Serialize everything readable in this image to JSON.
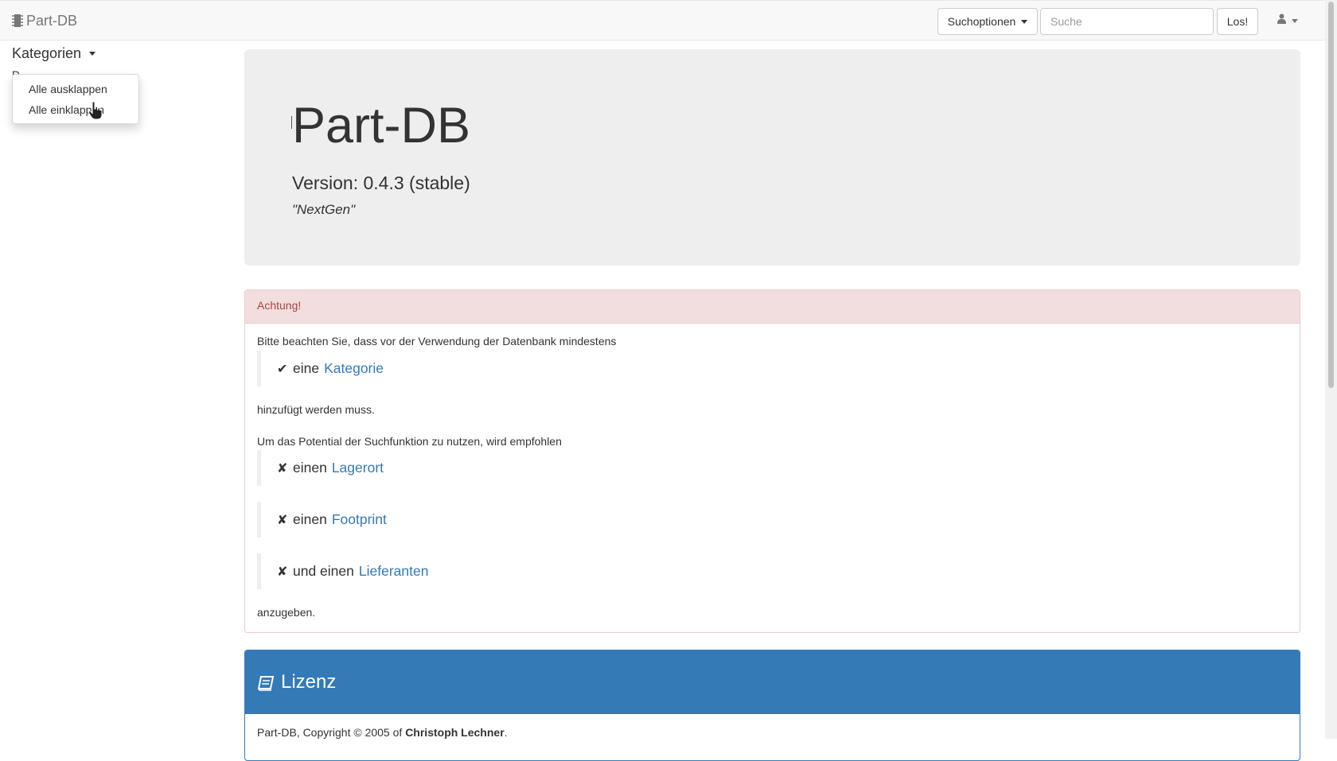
{
  "navbar": {
    "brand": "Part-DB",
    "search_options_label": "Suchoptionen",
    "search_placeholder": "Suche",
    "search_value": "",
    "go_label": "Los!",
    "user_icon": "user-icon"
  },
  "sidebar": {
    "title": "Kategorien",
    "stub_text": "D",
    "dropdown": [
      {
        "label": "Alle ausklappen"
      },
      {
        "label": "Alle einklappen"
      }
    ]
  },
  "jumbotron": {
    "title": "Part-DB",
    "version": "Version: 0.4.3 (stable)",
    "codename": "\"NextGen\""
  },
  "warning": {
    "heading": "Achtung!",
    "intro": "Bitte beachten Sie, dass vor der Verwendung der Datenbank mindestens",
    "required": {
      "mark": "✔",
      "prefix": "eine",
      "link": "Kategorie"
    },
    "after_required": "hinzufügt werden muss.",
    "recommend_intro": "Um das Potential der Suchfunktion zu nutzen, wird empfohlen",
    "recommended": [
      {
        "mark": "✘",
        "prefix": "einen",
        "link": "Lagerort"
      },
      {
        "mark": "✘",
        "prefix": "einen",
        "link": "Footprint"
      },
      {
        "mark": "✘",
        "prefix": "und einen",
        "link": "Lieferanten"
      }
    ],
    "outro": "anzugeben."
  },
  "license": {
    "heading": "Lizenz",
    "text_prefix": "Part-DB, Copyright © 2005 of",
    "author": "Christoph Lechner",
    "text_suffix": "."
  },
  "colors": {
    "link": "#337ab7",
    "danger_heading_bg": "#f2dede",
    "danger_text": "#a94442",
    "primary": "#337ab7",
    "jumbotron_bg": "#eeeeee"
  }
}
